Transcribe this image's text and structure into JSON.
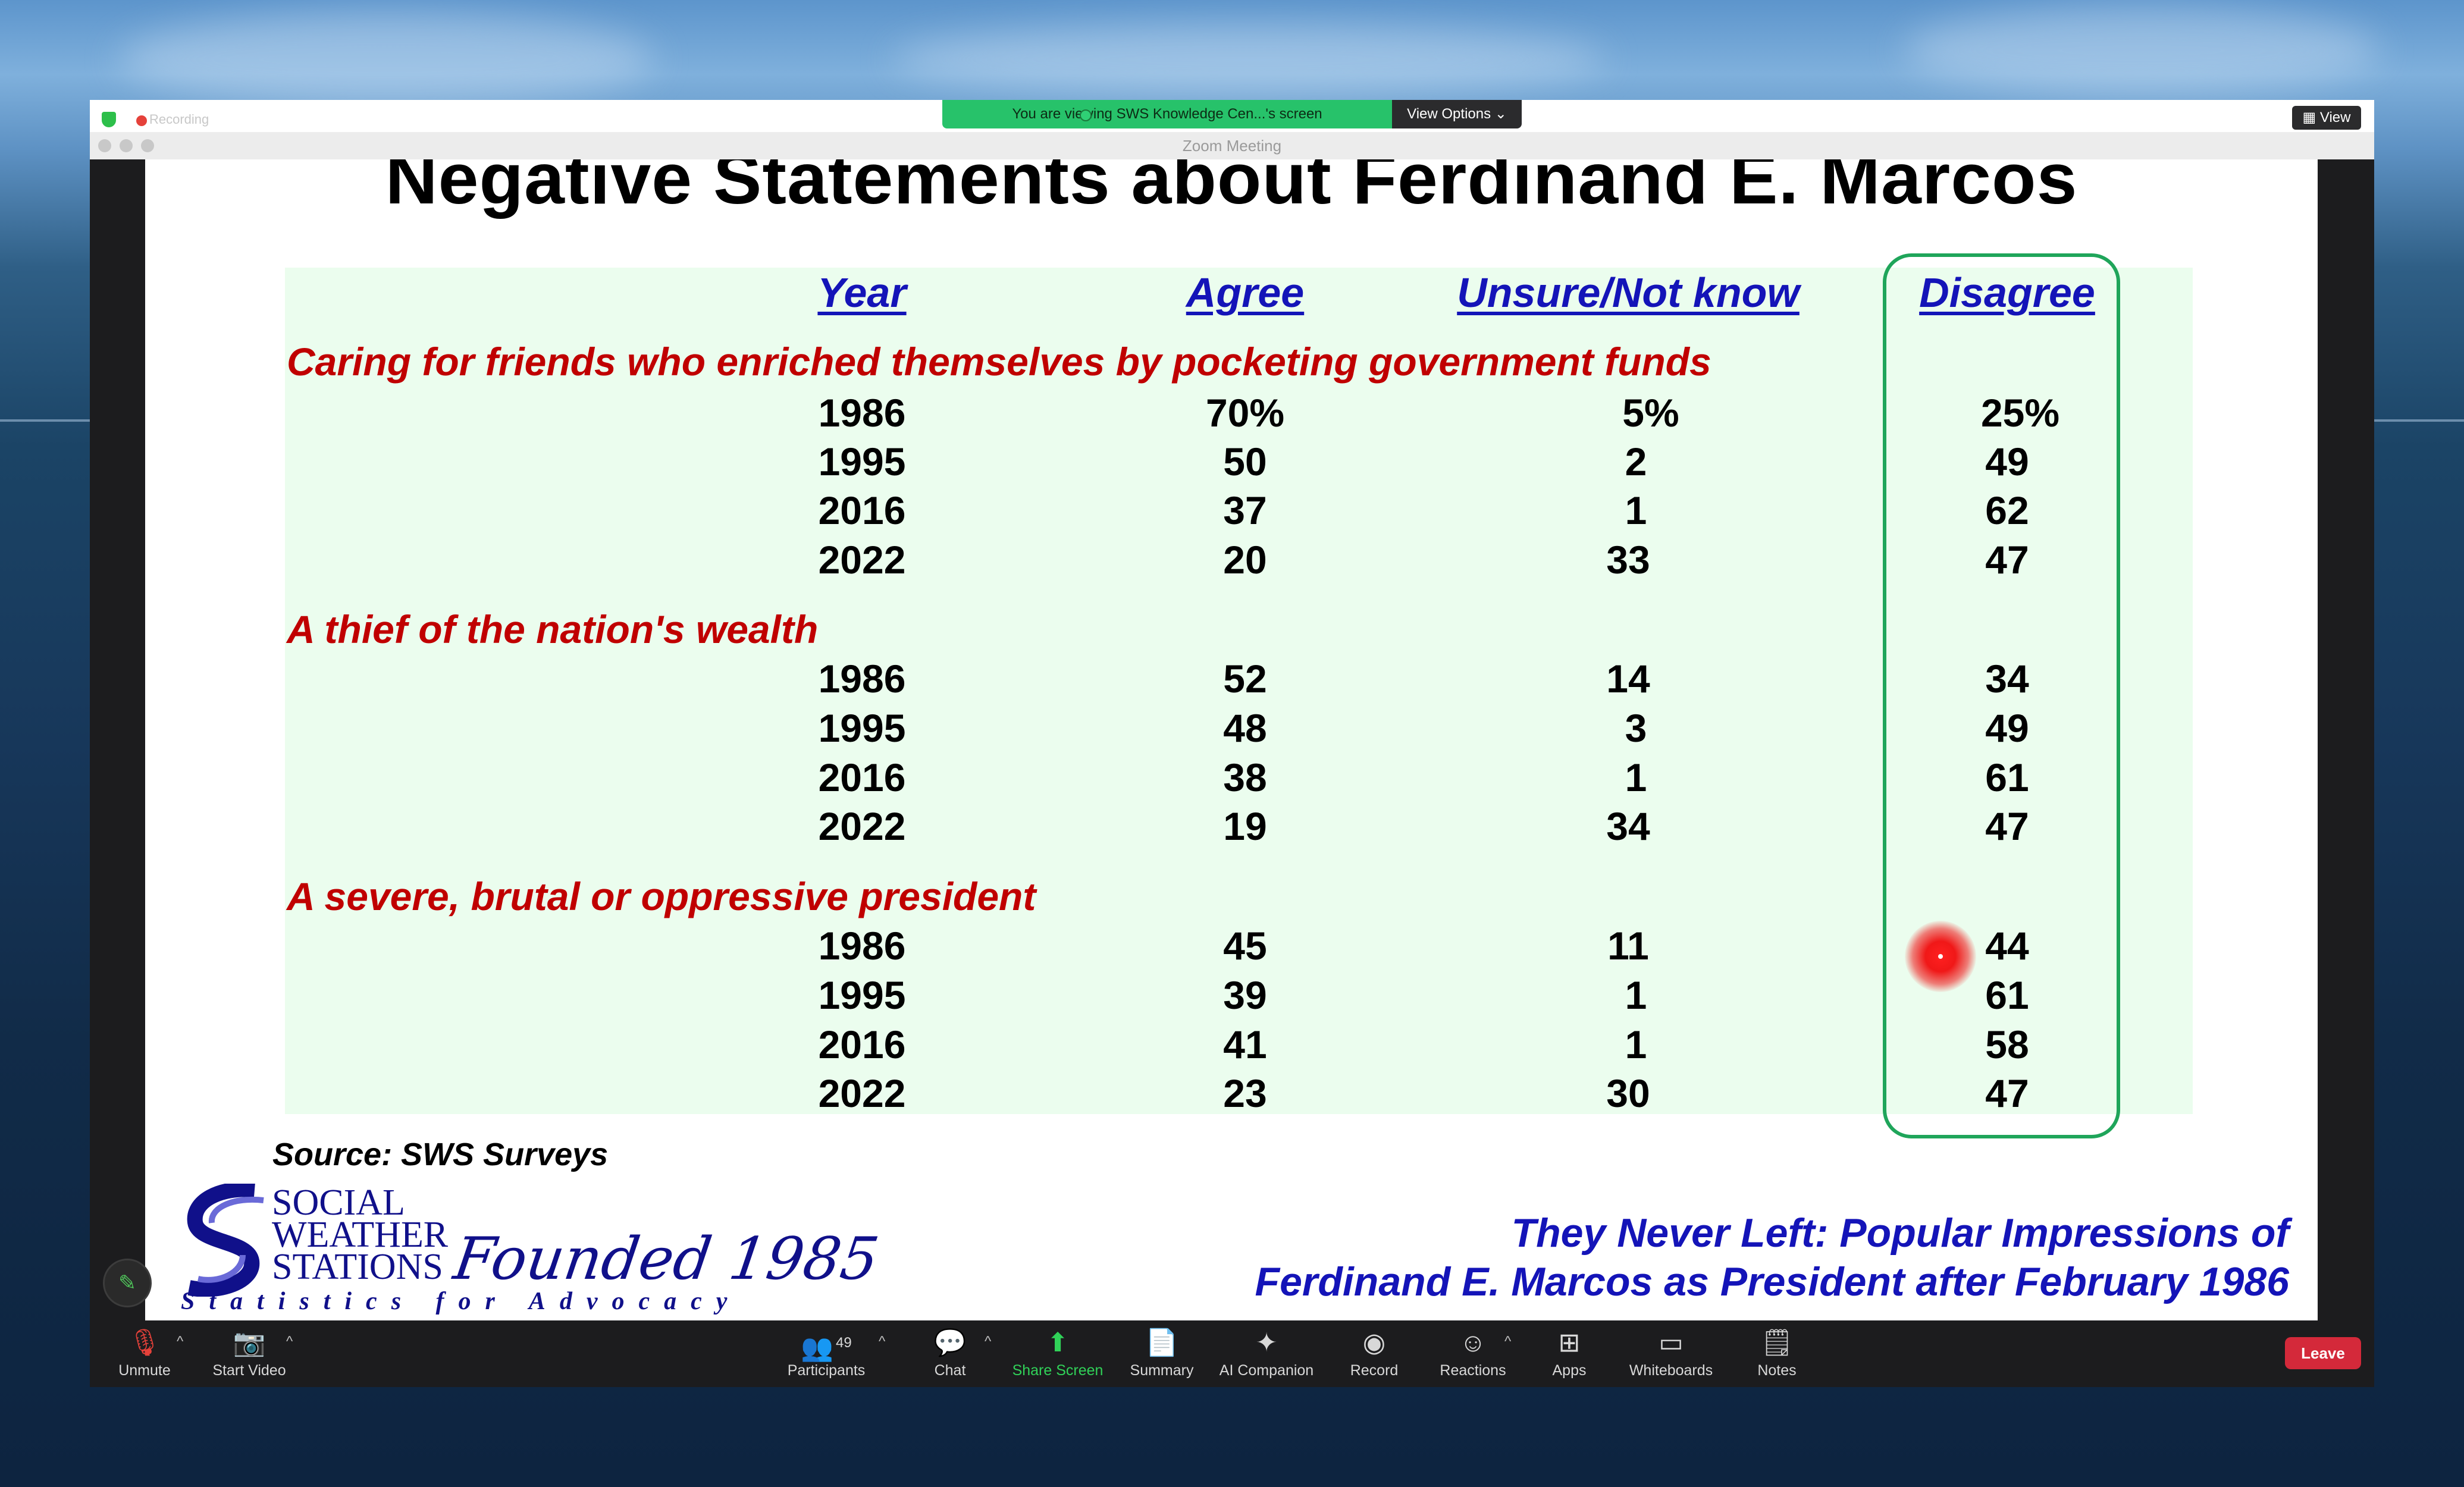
{
  "window": {
    "title": "Zoom Meeting",
    "recording_label": "Recording",
    "viewing_banner": "You are viewing SWS Knowledge Cen...'s screen",
    "view_options_label": "View Options ⌄",
    "view_label": "View"
  },
  "slide": {
    "title": "Negative Statements about Ferdinand E. Marcos",
    "headers": {
      "year": "Year",
      "agree": "Agree",
      "unsure": "Unsure/Not know",
      "disagree": "Disagree"
    },
    "sections": [
      {
        "title": "Caring for friends who enriched themselves by pocketing government funds",
        "rows": [
          {
            "year": "1986",
            "agree": "70%",
            "unsure": "5%",
            "disagree": "25%"
          },
          {
            "year": "1995",
            "agree": "50",
            "unsure": "2",
            "disagree": "49"
          },
          {
            "year": "2016",
            "agree": "37",
            "unsure": "1",
            "disagree": "62"
          },
          {
            "year": "2022",
            "agree": "20",
            "unsure": "33",
            "disagree": "47"
          }
        ]
      },
      {
        "title": "A thief of the nation's wealth",
        "rows": [
          {
            "year": "1986",
            "agree": "52",
            "unsure": "14",
            "disagree": "34"
          },
          {
            "year": "1995",
            "agree": "48",
            "unsure": "3",
            "disagree": "49"
          },
          {
            "year": "2016",
            "agree": "38",
            "unsure": "1",
            "disagree": "61"
          },
          {
            "year": "2022",
            "agree": "19",
            "unsure": "34",
            "disagree": "47"
          }
        ]
      },
      {
        "title": "A severe, brutal or oppressive president",
        "rows": [
          {
            "year": "1986",
            "agree": "45",
            "unsure": "11",
            "disagree": "44"
          },
          {
            "year": "1995",
            "agree": "39",
            "unsure": "1",
            "disagree": "61"
          },
          {
            "year": "2016",
            "agree": "41",
            "unsure": "1",
            "disagree": "58"
          },
          {
            "year": "2022",
            "agree": "23",
            "unsure": "30",
            "disagree": "47"
          }
        ]
      }
    ],
    "source": "Source: SWS Surveys",
    "logo": {
      "line1": "SOCIAL",
      "line2": "WEATHER",
      "line3": "STATIONS",
      "founded": "Founded 1985",
      "tagline": "Statistics for Advocacy"
    },
    "presentation_title_line1": "They Never Left: Popular Impressions of",
    "presentation_title_line2": "Ferdinand E. Marcos as President after February 1986"
  },
  "toolbar": {
    "unmute": "Unmute",
    "start_video": "Start Video",
    "participants": "Participants",
    "participants_count": "49",
    "chat": "Chat",
    "share_screen": "Share Screen",
    "summary": "Summary",
    "ai_companion": "AI Companion",
    "record": "Record",
    "reactions": "Reactions",
    "apps": "Apps",
    "whiteboards": "Whiteboards",
    "notes": "Notes",
    "leave": "Leave"
  },
  "colors": {
    "header_blue": "#1414b8",
    "section_red": "#c00000",
    "highlight_green": "#1fa55a",
    "share_green": "#30d158",
    "leave_red": "#d4293a"
  }
}
